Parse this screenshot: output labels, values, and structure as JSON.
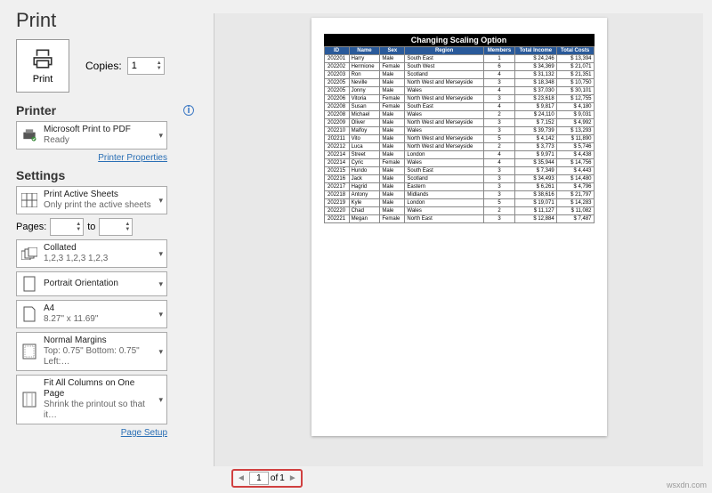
{
  "header": {
    "title": "Print"
  },
  "print": {
    "button": "Print",
    "copies_label": "Copies:",
    "copies_value": "1"
  },
  "printer": {
    "heading": "Printer",
    "device": "Microsoft Print to PDF",
    "status": "Ready",
    "properties_link": "Printer Properties"
  },
  "settings": {
    "heading": "Settings",
    "what": {
      "t1": "Print Active Sheets",
      "t2": "Only print the active sheets"
    },
    "pages_label": "Pages:",
    "pages_to": "to",
    "collate": {
      "t1": "Collated",
      "t2": "1,2,3   1,2,3   1,2,3"
    },
    "orient": {
      "t1": "Portrait Orientation",
      "t2": ""
    },
    "paper": {
      "t1": "A4",
      "t2": "8.27\" x 11.69\""
    },
    "margins": {
      "t1": "Normal Margins",
      "t2": "Top: 0.75\" Bottom: 0.75\" Left:…"
    },
    "scaling": {
      "t1": "Fit All Columns on One Page",
      "t2": "Shrink the printout so that it…"
    },
    "page_setup_link": "Page Setup"
  },
  "preview": {
    "title": "Changing Scaling Option",
    "cols": [
      "ID",
      "Name",
      "Sex",
      "Region",
      "Members",
      "Total Income",
      "Total Costs"
    ],
    "rows": [
      [
        "202201",
        "Harry",
        "Male",
        "South East",
        "1",
        "$ 24,246",
        "$ 13,394"
      ],
      [
        "202202",
        "Hermione",
        "Female",
        "South West",
        "6",
        "$ 34,369",
        "$ 21,071"
      ],
      [
        "202203",
        "Ron",
        "Male",
        "Scotland",
        "4",
        "$ 31,132",
        "$ 21,351"
      ],
      [
        "202205",
        "Neville",
        "Male",
        "North West and Merseyside",
        "3",
        "$ 18,348",
        "$ 10,750"
      ],
      [
        "202205",
        "Jonny",
        "Male",
        "Wales",
        "4",
        "$ 37,030",
        "$ 30,101"
      ],
      [
        "202206",
        "Vitoria",
        "Female",
        "North West and Merseyside",
        "3",
        "$ 23,618",
        "$ 12,755"
      ],
      [
        "202208",
        "Susan",
        "Female",
        "South East",
        "4",
        "$ 9,817",
        "$ 4,180"
      ],
      [
        "202208",
        "Michael",
        "Male",
        "Wales",
        "2",
        "$ 24,110",
        "$ 9,031"
      ],
      [
        "202209",
        "Oliver",
        "Male",
        "North West and Merseyside",
        "3",
        "$ 7,152",
        "$ 4,992"
      ],
      [
        "202210",
        "Malfoy",
        "Male",
        "Wales",
        "3",
        "$ 39,739",
        "$ 13,293"
      ],
      [
        "202211",
        "Vito",
        "Male",
        "North West and Merseyside",
        "5",
        "$ 4,142",
        "$ 11,890"
      ],
      [
        "202212",
        "Luca",
        "Male",
        "North West and Merseyside",
        "2",
        "$ 3,773",
        "$ 5,746"
      ],
      [
        "202214",
        "Street",
        "Male",
        "London",
        "4",
        "$ 9,971",
        "$ 4,438"
      ],
      [
        "202214",
        "Cyric",
        "Female",
        "Wales",
        "4",
        "$ 35,944",
        "$ 14,756"
      ],
      [
        "202215",
        "Hundo",
        "Male",
        "South East",
        "3",
        "$ 7,349",
        "$ 4,443"
      ],
      [
        "202216",
        "Jack",
        "Male",
        "Scotland",
        "3",
        "$ 34,493",
        "$ 14,480"
      ],
      [
        "202217",
        "Hagrid",
        "Male",
        "Eastern",
        "3",
        "$ 6,261",
        "$ 4,796"
      ],
      [
        "202218",
        "Antony",
        "Male",
        "Midlands",
        "3",
        "$ 38,616",
        "$ 21,797"
      ],
      [
        "202219",
        "Kyle",
        "Male",
        "London",
        "5",
        "$ 19,071",
        "$ 14,283"
      ],
      [
        "202220",
        "Chad",
        "Male",
        "Wales",
        "2",
        "$ 11,127",
        "$ 11,082"
      ],
      [
        "202221",
        "Megan",
        "Female",
        "North East",
        "3",
        "$ 12,884",
        "$ 7,487"
      ]
    ]
  },
  "pager": {
    "current": "1",
    "of": "of",
    "total": "1"
  },
  "watermark": "wsxdn.com"
}
